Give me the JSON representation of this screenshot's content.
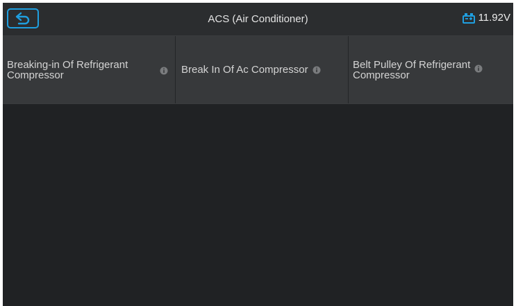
{
  "header": {
    "back_icon": "back-arrow-icon",
    "title": "ACS (Air Conditioner)",
    "battery_icon": "car-battery-icon",
    "voltage": "11.92V",
    "accent_color": "#1f9fe0"
  },
  "menu": {
    "items": [
      {
        "label_line1": "Breaking-in Of Refrigerant",
        "label_line2": "Compressor",
        "icon": "info-icon"
      },
      {
        "label": "Break In Of Ac Compressor",
        "icon": "info-icon"
      },
      {
        "label_line1": "Belt Pulley Of Refrigerant",
        "label_line2": "Compressor",
        "icon": "info-icon"
      }
    ]
  }
}
